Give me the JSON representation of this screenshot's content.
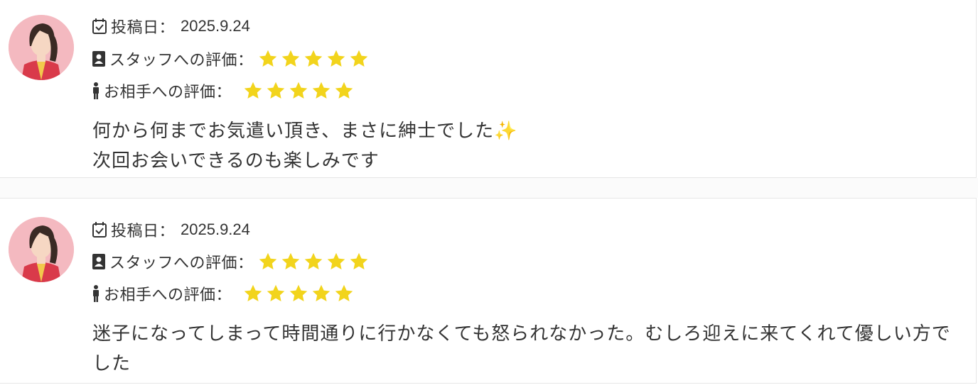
{
  "labels": {
    "posted": "投稿日：",
    "staff_rating": "スタッフへの評価：",
    "partner_rating": "お相手への評価："
  },
  "colors": {
    "star": "#f2d41c",
    "avatar_bg": "#f4b9c0"
  },
  "icons": {
    "posted": "calendar-check-icon",
    "staff": "id-badge-icon",
    "partner": "person-icon",
    "rating": "star-icon"
  },
  "reviews": [
    {
      "date": "2025.9.24",
      "staff_stars": 5,
      "partner_stars": 5,
      "comment": "何から何までお気遣い頂き、まさに紳士でした✨\n次回お会いできるのも楽しみです"
    },
    {
      "date": "2025.9.24",
      "staff_stars": 5,
      "partner_stars": 5,
      "comment": "迷子になってしまって時間通りに行かなくても怒られなかった。むしろ迎えに来てくれて優しい方でした"
    }
  ]
}
